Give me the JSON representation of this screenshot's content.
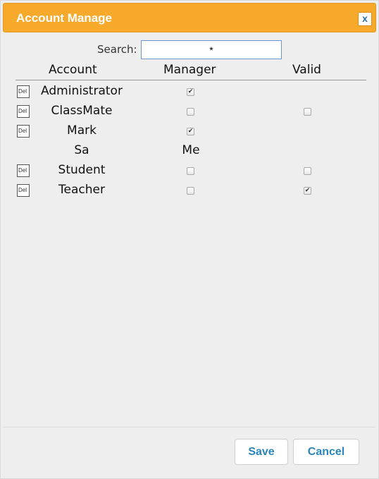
{
  "dialog": {
    "title": "Account Manage",
    "close_label": "x"
  },
  "search": {
    "label": "Search:",
    "value": "*"
  },
  "columns": {
    "account": "Account",
    "manager": "Manager",
    "valid": "Valid"
  },
  "del_label": "Del",
  "rows": [
    {
      "account": "Administrator",
      "has_del": true,
      "manager": true,
      "valid": null
    },
    {
      "account": "ClassMate",
      "has_del": true,
      "manager": false,
      "valid": false
    },
    {
      "account": "Mark",
      "has_del": true,
      "manager": true,
      "valid": null
    },
    {
      "account": "Sa",
      "has_del": false,
      "manager_text": "Me",
      "valid": null
    },
    {
      "account": "Student",
      "has_del": true,
      "manager": false,
      "valid": false
    },
    {
      "account": "Teacher",
      "has_del": true,
      "manager": false,
      "valid": true
    }
  ],
  "buttons": {
    "save": "Save",
    "cancel": "Cancel"
  },
  "colors": {
    "titlebar": "#f6a92b",
    "button_text": "#2a86b8"
  }
}
